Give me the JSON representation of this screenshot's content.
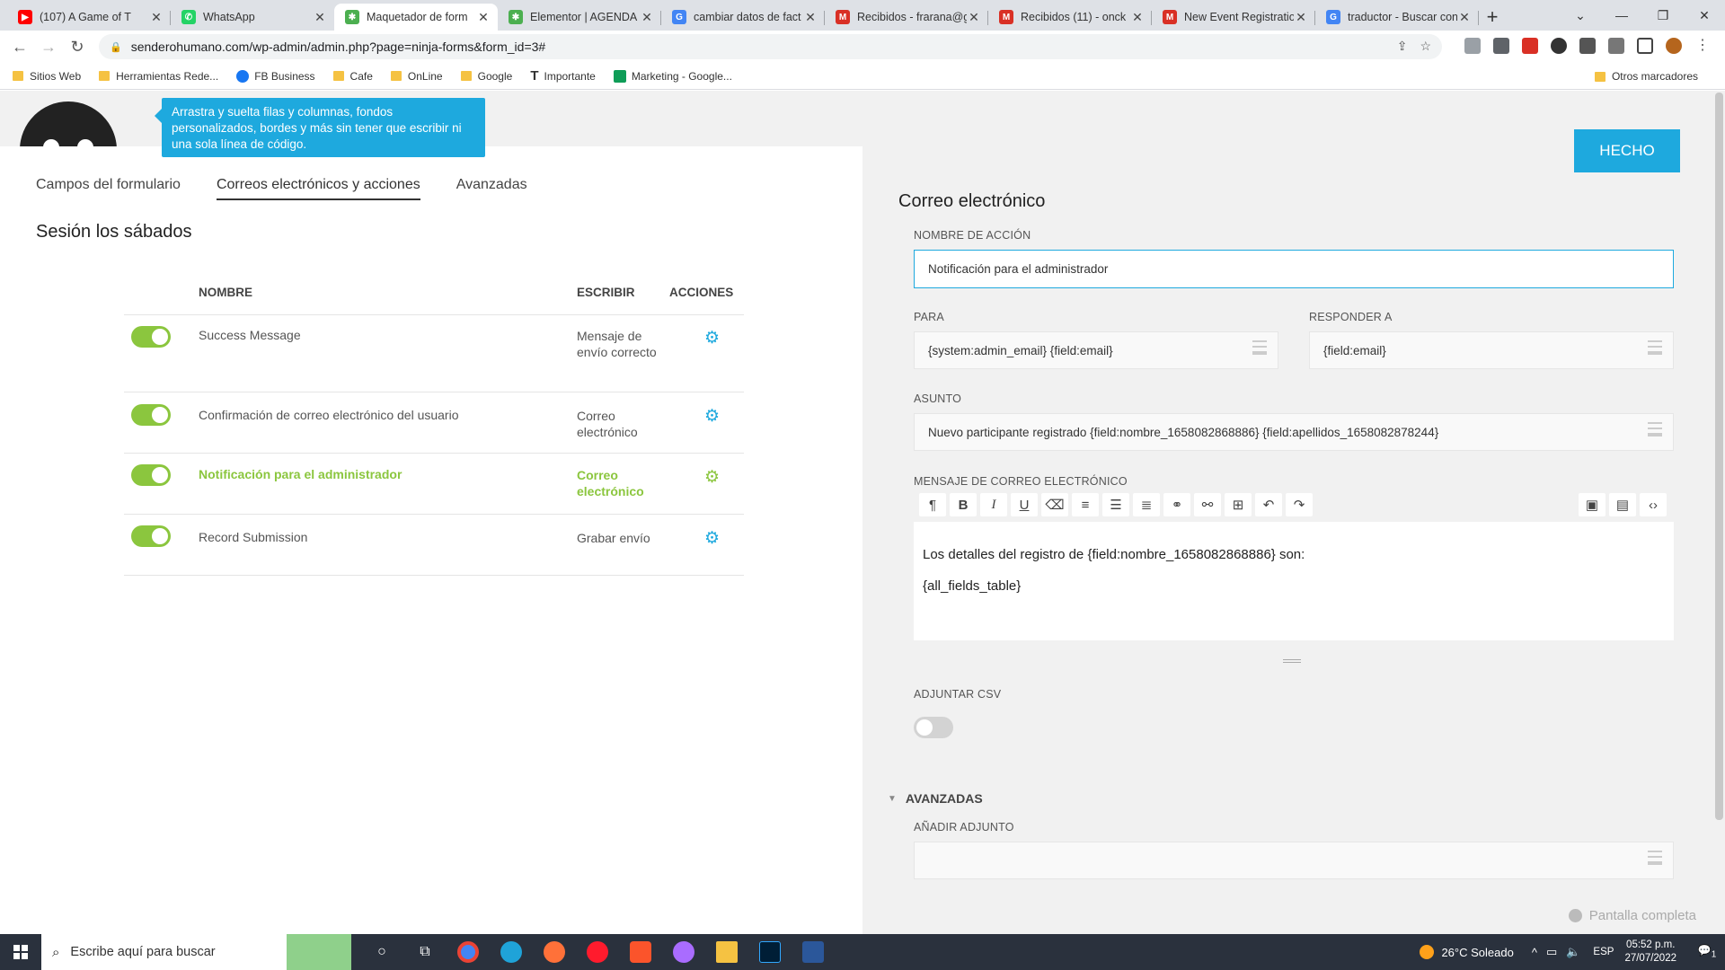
{
  "browser": {
    "tabs": [
      {
        "title": "(107) A Game of T",
        "color": "#ff0000",
        "glyph": "▶"
      },
      {
        "title": "WhatsApp",
        "color": "#25d366",
        "glyph": "✆"
      },
      {
        "title": "Maquetador de form",
        "color": "#4caf50",
        "glyph": "✱"
      },
      {
        "title": "Elementor | AGENDA T",
        "color": "#4caf50",
        "glyph": "✱"
      },
      {
        "title": "cambiar datos de fact",
        "color": "#4285f4",
        "glyph": "G"
      },
      {
        "title": "Recibidos - frarana@g",
        "color": "#d93025",
        "glyph": "M"
      },
      {
        "title": "Recibidos (11) - onck",
        "color": "#d93025",
        "glyph": "M"
      },
      {
        "title": "New Event Registratio",
        "color": "#d93025",
        "glyph": "M"
      },
      {
        "title": "traductor - Buscar con",
        "color": "#4285f4",
        "glyph": "G"
      }
    ],
    "url": "senderohumano.com/wp-admin/admin.php?page=ninja-forms&form_id=3#",
    "bookmarks": [
      "Sitios Web",
      "Herramientas Rede...",
      "FB Business",
      "Cafe",
      "OnLine",
      "Google",
      "Importante",
      "Marketing - Google..."
    ],
    "other_bookmarks": "Otros marcadores"
  },
  "builder": {
    "tooltip": "Arrastra y suelta filas y columnas, fondos personalizados, bordes y más sin tener que escribir ni una sola línea de código.",
    "tabs": [
      "Campos del formulario",
      "Correos electrónicos y acciones",
      "Avanzadas"
    ],
    "form_title": "Sesión los sábados",
    "table": {
      "headers": {
        "name": "NOMBRE",
        "type": "ESCRIBIR",
        "actions": "ACCIONES"
      },
      "rows": [
        {
          "name": "Success Message",
          "type": "Mensaje de envío correcto",
          "enabled": true,
          "highlighted": false
        },
        {
          "name": "Confirmación de correo electrónico del usuario",
          "type": "Correo electrónico",
          "enabled": true,
          "highlighted": false
        },
        {
          "name": "Notificación para el administrador",
          "type": "Correo electrónico",
          "enabled": true,
          "highlighted": true
        },
        {
          "name": "Record Submission",
          "type": "Grabar envío",
          "enabled": true,
          "highlighted": false
        }
      ]
    }
  },
  "drawer": {
    "done_label": "HECHO",
    "title": "Correo electrónico",
    "action_name_label": "NOMBRE DE ACCIÓN",
    "action_name_value": "Notificación para el administrador",
    "to_label": "PARA",
    "to_value": "{system:admin_email} {field:email}",
    "reply_label": "RESPONDER A",
    "reply_value": "{field:email}",
    "subject_label": "ASUNTO",
    "subject_value": "Nuevo participante registrado {field:nombre_1658082868886} {field:apellidos_1658082878244}",
    "message_label": "MENSAJE DE CORREO ELECTRÓNICO",
    "message_lines": [
      "Los detalles del registro de {field:nombre_1658082868886} son:",
      "{all_fields_table}"
    ],
    "csv_label": "ADJUNTAR CSV",
    "csv_enabled": false,
    "advanced_label": "AVANZADAS",
    "attach_label": "AÑADIR ADJUNTO",
    "fullscreen_label": "Pantalla completa"
  },
  "taskbar": {
    "search_placeholder": "Escribe aquí para buscar",
    "weather": "26°C  Soleado",
    "lang": "ESP",
    "time": "05:52 p.m.",
    "date": "27/07/2022",
    "notifications": "1"
  }
}
